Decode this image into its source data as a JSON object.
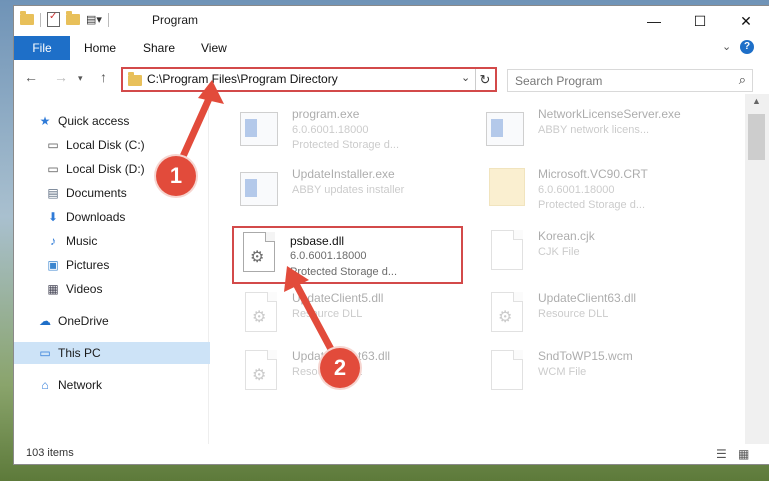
{
  "window": {
    "title": "Program"
  },
  "ribbon": {
    "file_tab": "File",
    "tabs": [
      "Home",
      "Share",
      "View"
    ]
  },
  "address_bar": {
    "path": "C:\\Program Files\\Program Directory",
    "highlight_color": "#d34a4a"
  },
  "search": {
    "placeholder": "Search Program"
  },
  "sidebar": {
    "items": [
      {
        "label": "Quick access",
        "icon": "star-icon"
      },
      {
        "label": "Local Disk (C:)",
        "icon": "drive-icon",
        "pinned": true
      },
      {
        "label": "Local Disk (D:)",
        "icon": "drive-icon",
        "pinned": true
      },
      {
        "label": "Documents",
        "icon": "documents-icon",
        "pinned": true
      },
      {
        "label": "Downloads",
        "icon": "downloads-icon",
        "pinned": true
      },
      {
        "label": "Music",
        "icon": "music-icon",
        "pinned": true
      },
      {
        "label": "Pictures",
        "icon": "pictures-icon",
        "pinned": true
      },
      {
        "label": "Videos",
        "icon": "videos-icon",
        "pinned": true
      },
      {
        "label": "OneDrive",
        "icon": "onedrive-icon"
      },
      {
        "label": "This PC",
        "icon": "computer-icon",
        "selected": true
      },
      {
        "label": "Network",
        "icon": "network-icon"
      }
    ]
  },
  "files": [
    {
      "name": "program.exe",
      "line2": "6.0.6001.18000",
      "line3": "Protected Storage d...",
      "icon": "exe-icon"
    },
    {
      "name": "NetworkLicenseServer.exe",
      "line2": "ABBY network licens...",
      "line3": "",
      "icon": "exe-icon"
    },
    {
      "name": "UpdateInstaller.exe",
      "line2": "ABBY updates installer",
      "line3": "",
      "icon": "exe-icon"
    },
    {
      "name": "Microsoft.VC90.CRT",
      "line2": "6.0.6001.18000",
      "line3": "Protected Storage d...",
      "icon": "folder-icon"
    },
    {
      "name": "psbase.dll",
      "line2": "6.0.6001.18000",
      "line3": "Protected Storage d...",
      "icon": "dll-icon",
      "highlighted": true
    },
    {
      "name": "Korean.cjk",
      "line2": "CJK File",
      "line3": "",
      "icon": "file-icon"
    },
    {
      "name": "UpdateClient5.dll",
      "line2": "Resource DLL",
      "line3": "",
      "icon": "dll-icon"
    },
    {
      "name": "UpdateClient63.dll",
      "line2": "Resource DLL",
      "line3": "",
      "icon": "dll-icon"
    },
    {
      "name": "UpdateClient63.dll",
      "line2": "Resource DLL",
      "line3": "",
      "icon": "dll-icon"
    },
    {
      "name": "SndToWP15.wcm",
      "line2": "WCM File",
      "line3": "",
      "icon": "file-icon"
    }
  ],
  "status": {
    "items_count": "103 items"
  },
  "annotations": {
    "step1": "1",
    "step2": "2",
    "color": "#e24b3b"
  }
}
